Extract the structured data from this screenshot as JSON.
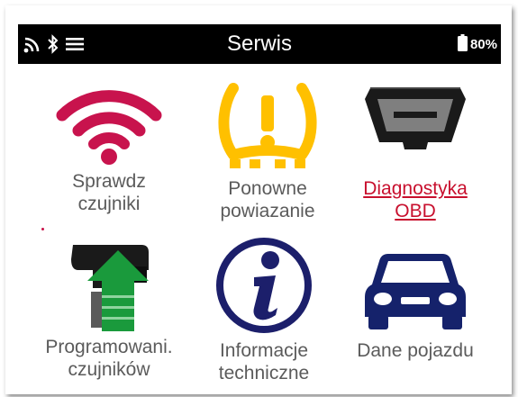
{
  "header": {
    "title": "Serwis",
    "battery": "80%",
    "status_icons": [
      "wifi-icon",
      "bluetooth-icon",
      "menu-icon"
    ]
  },
  "menu": {
    "items": [
      {
        "id": "check-sensors",
        "label": "Sprawdz\nczujniki",
        "icon": "wifi-signal-icon",
        "color": "#c8134d"
      },
      {
        "id": "relearn",
        "label": "Ponowne\npowiazanie",
        "icon": "tpms-warning-icon",
        "color": "#ffc000"
      },
      {
        "id": "obd",
        "label": "Diagnostyka\nOBD",
        "icon": "obd-connector-icon",
        "color": "#c8102e",
        "active": true
      },
      {
        "id": "program-sensors",
        "label": "Programowani.\nczujników",
        "icon": "sensor-program-icon",
        "color": "#1a9a3c"
      },
      {
        "id": "tech-info",
        "label": "Informacje\ntechniczne",
        "icon": "info-icon",
        "color": "#1c1f6b"
      },
      {
        "id": "vehicle-data",
        "label": "Dane pojazdu",
        "icon": "car-icon",
        "color": "#15226b"
      }
    ]
  },
  "colors": {
    "label_gray": "#5b5b5b",
    "link_red": "#c8102e",
    "status_bar": "#000000"
  }
}
